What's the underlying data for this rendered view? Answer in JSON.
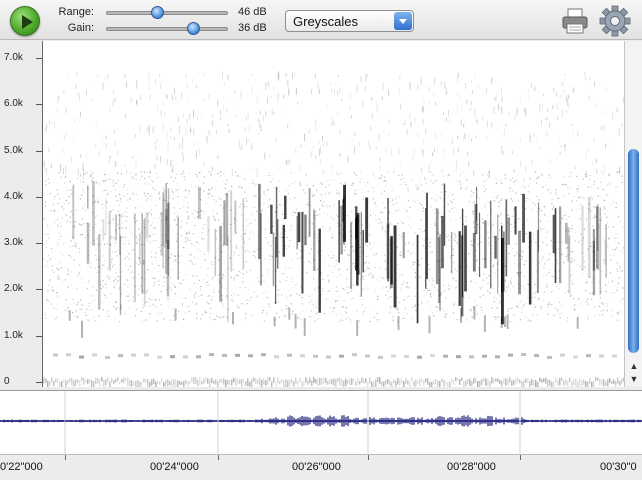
{
  "toolbar": {
    "range": {
      "label": "Range:",
      "value": "46 dB",
      "level": 0.42
    },
    "gain": {
      "label": "Gain:",
      "value": "36 dB",
      "level": 0.72
    },
    "palette": {
      "selected": "Greyscales"
    },
    "icons": {
      "play": "play-icon",
      "print": "print-icon",
      "settings": "gear-icon",
      "dropdown": "chevron-down-icon"
    }
  },
  "spectrogram": {
    "y_ticks": [
      "7.0k",
      "6.0k",
      "5.0k",
      "4.0k",
      "3.0k",
      "2.0k",
      "1.0k",
      "0"
    ]
  },
  "timeline": {
    "ticks": [
      "0'22\"000",
      "00'24\"000",
      "00'26\"000",
      "00'28\"000",
      "00'30\"0"
    ]
  },
  "colors": {
    "accent": "#2e6fd0",
    "play": "#4eaa2a",
    "waveform": "#1a1a7a"
  }
}
